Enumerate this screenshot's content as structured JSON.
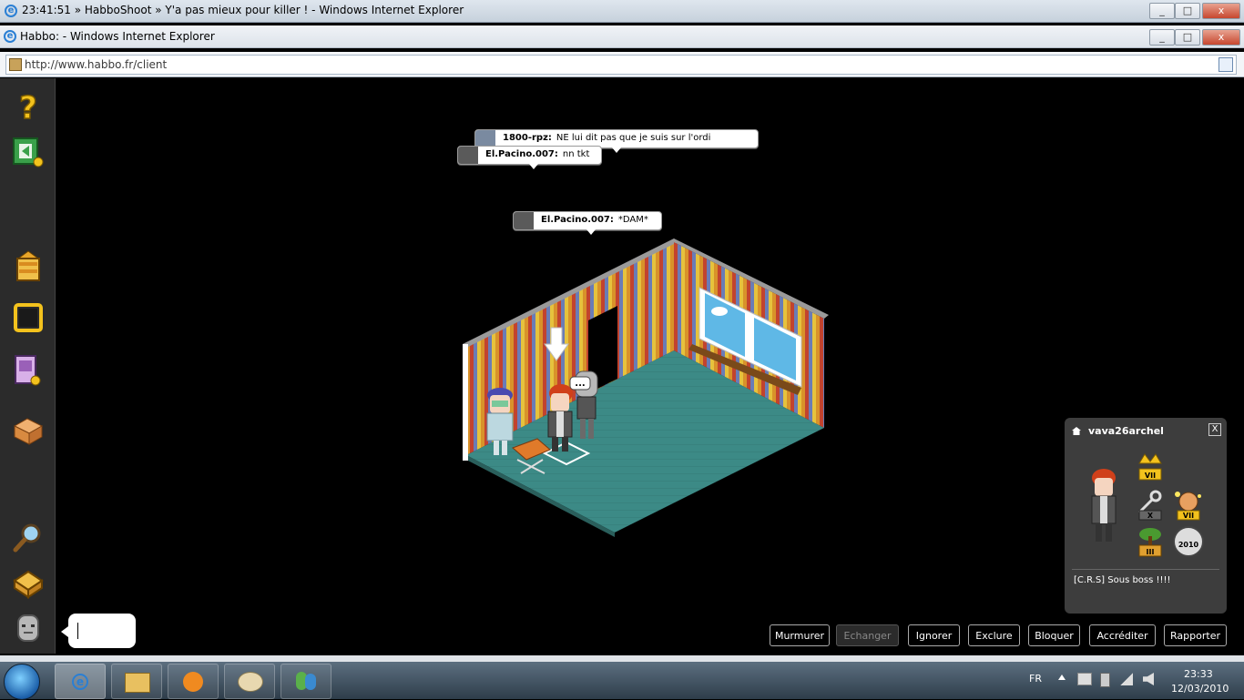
{
  "outer_window": {
    "title": "23:41:51 » HabboShoot » Y'a pas mieux pour killer ! - Windows Internet Explorer"
  },
  "browser": {
    "title": "Habbo: - Windows Internet Explorer",
    "address": "http://www.habbo.fr/client"
  },
  "chat": {
    "bubbles": [
      {
        "name": "1800-rpz:",
        "text": "NE lui dit pas que je suis sur  l'ordi"
      },
      {
        "name": "El.Pacino.007:",
        "text": "nn tkt"
      },
      {
        "name": "El.Pacino.007:",
        "text": "*DAM*"
      }
    ],
    "typing_indicator": "...",
    "input_value": ""
  },
  "info_panel": {
    "username": "vava26archel",
    "close_label": "X",
    "motto": "[C.R.S] Sous boss !!!!",
    "badges": [
      {
        "icon": "crown-badge-icon",
        "label": "VII"
      },
      {
        "icon": "key-badge-icon",
        "label": "X"
      },
      {
        "icon": "bear-badge-icon",
        "label": "VII"
      },
      {
        "icon": "bonsai-badge-icon",
        "label": "III"
      },
      {
        "icon": "habbo-2010-badge-icon",
        "label": "2010"
      }
    ]
  },
  "actions": {
    "whisper": "Murmurer",
    "trade": "Echanger",
    "ignore": "Ignorer",
    "kick": "Exclure",
    "block": "Bloquer",
    "rights": "Accréditer",
    "report": "Rapporter"
  },
  "taskbar": {
    "language": "FR",
    "time": "23:33",
    "date": "12/03/2010"
  },
  "colors": {
    "toolbar": "#2b2b2b",
    "floor": "#3c8a86",
    "wall_stripes": [
      "#d8922a",
      "#c2432e",
      "#6a7cb6",
      "#e6c23d"
    ],
    "info_panel": "#3d3d3d"
  }
}
